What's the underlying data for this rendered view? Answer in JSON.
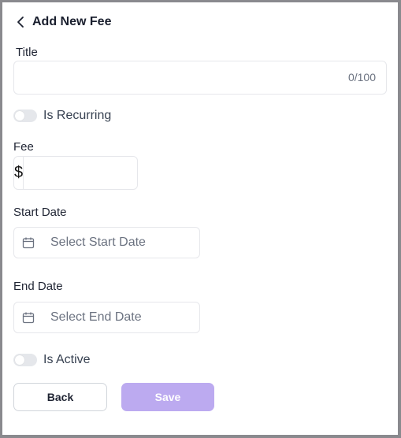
{
  "header": {
    "title": "Add New Fee",
    "back_icon": "chevron-left-icon"
  },
  "form": {
    "title_field": {
      "label": "Title",
      "value": "",
      "counter": "0/100"
    },
    "is_recurring": {
      "label": "Is Recurring",
      "checked": false
    },
    "fee_field": {
      "label": "Fee",
      "currency_symbol": "$",
      "value": ""
    },
    "start_date": {
      "label": "Start Date",
      "placeholder": "Select Start Date",
      "icon": "calendar-icon"
    },
    "end_date": {
      "label": "End Date",
      "placeholder": "Select End Date",
      "icon": "calendar-icon"
    },
    "is_active": {
      "label": "Is Active",
      "checked": false
    }
  },
  "actions": {
    "back_label": "Back",
    "save_label": "Save"
  },
  "colors": {
    "accent_disabled": "#bcaaf0",
    "toggle_off": "#e5e7eb",
    "border": "#e6e7eb"
  }
}
